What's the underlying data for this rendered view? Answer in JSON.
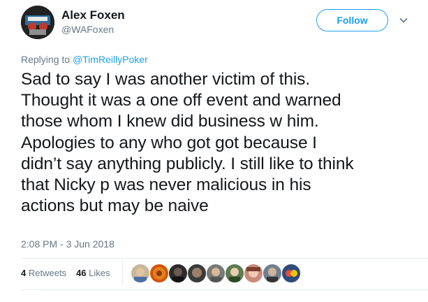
{
  "tweet": {
    "author_name": "Alex Foxen",
    "author_handle": "@WAFoxen",
    "follow_label": "Follow",
    "reply_prefix": "Replying to",
    "reply_to": "@TimReillyPoker",
    "text": "Sad to say I was another victim of this.\nThought it was a one off event and warned\nthose whom I knew did business w him.\nApologies to any who got got because I\ndidn’t say anything publicly. I still like to think\nthat Nicky p was never malicious in his\nactions but may be naive",
    "timestamp": "2:08 PM - 3 Jun 2018",
    "retweets_count": "4",
    "retweets_label": "Retweets",
    "likes_count": "46",
    "likes_label": "Likes"
  },
  "colors": {
    "accent": "#1da1f2",
    "muted": "#657786",
    "text": "#14171a",
    "divider": "#e6ecf0"
  },
  "icons": {
    "caret": "chevron-down-icon"
  }
}
